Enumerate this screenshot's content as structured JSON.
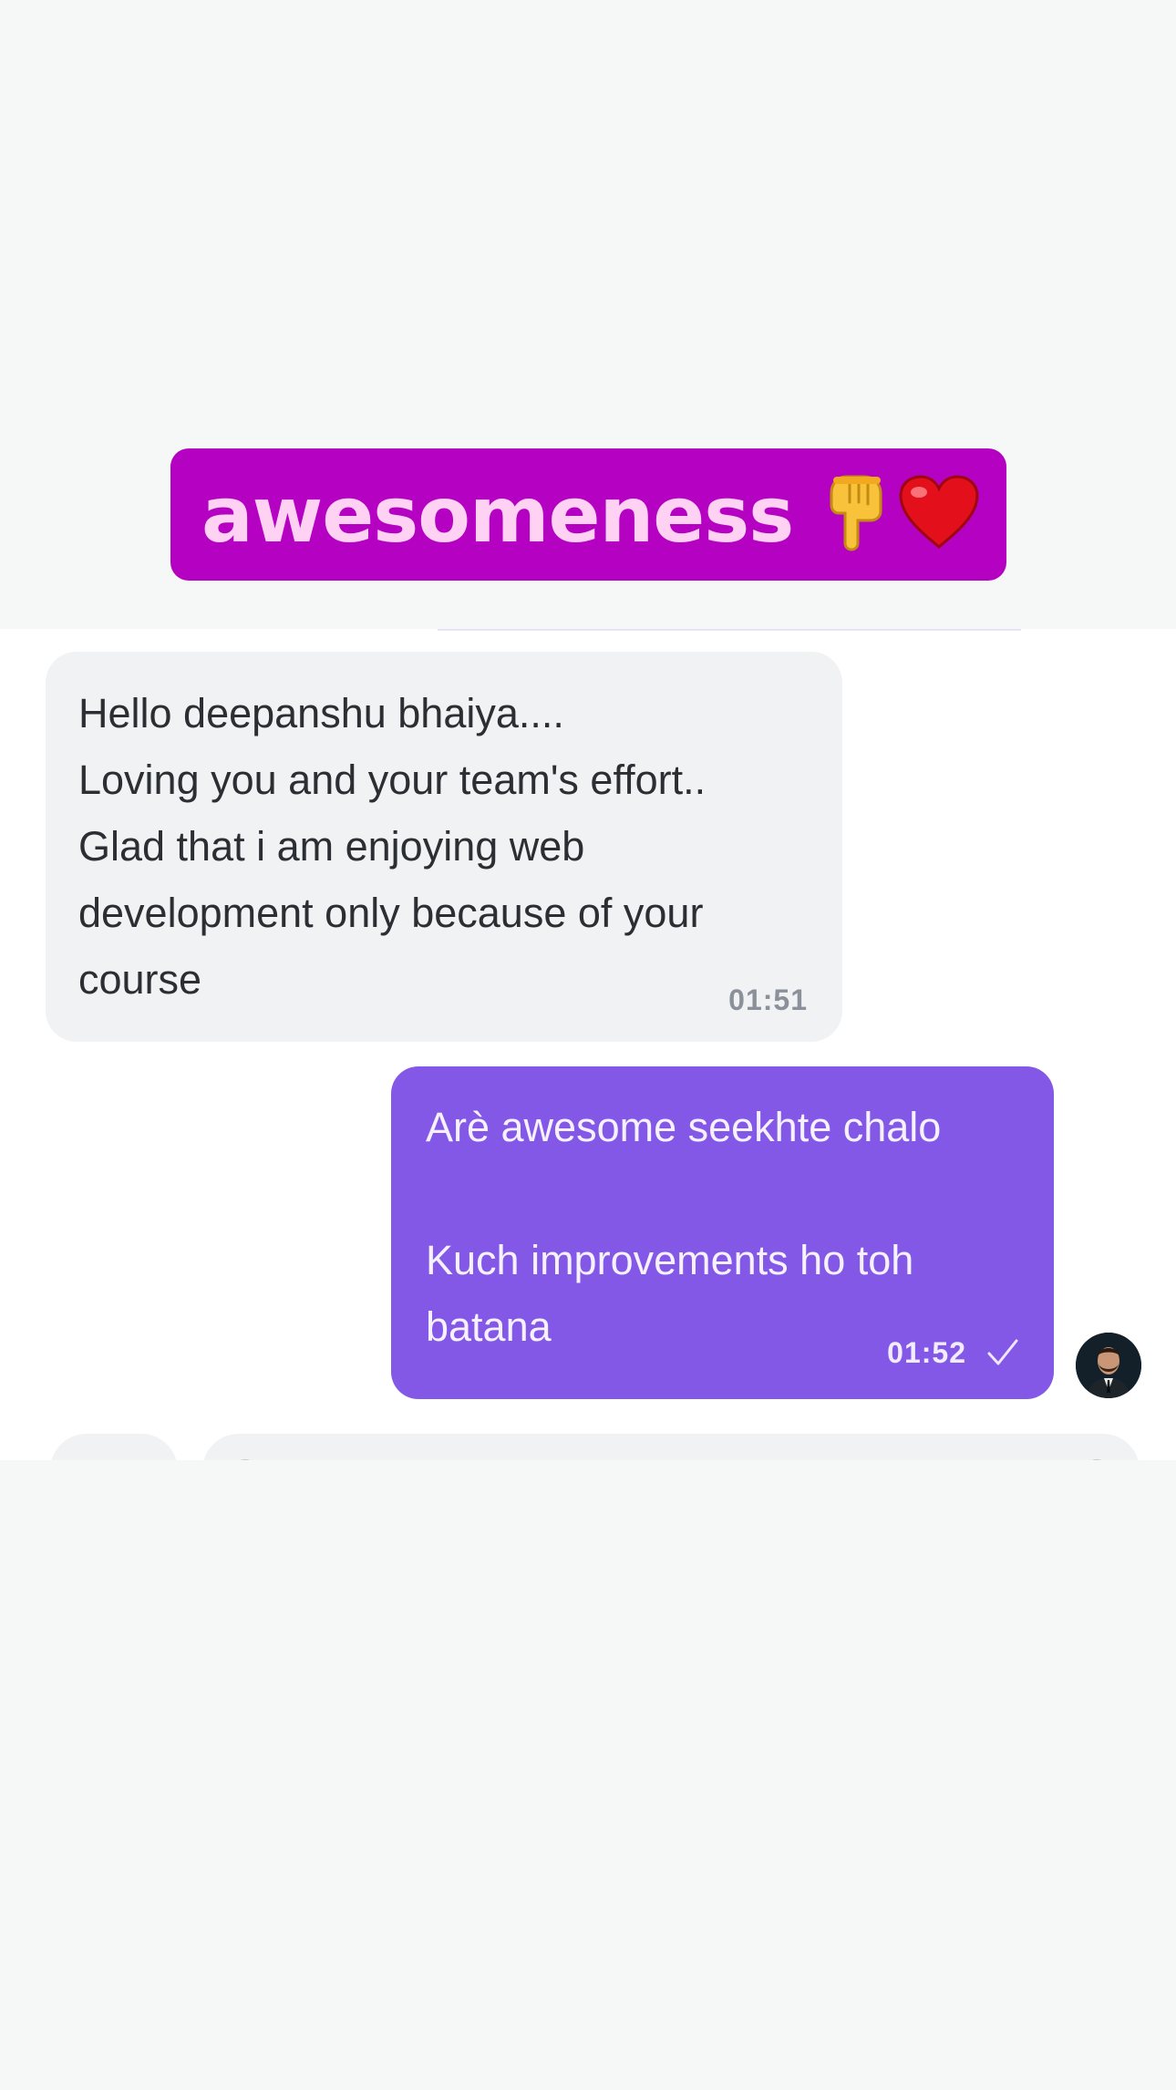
{
  "sticker": {
    "text": "awesomeness",
    "emoji_icons": [
      "pointing-down-hand-icon",
      "red-heart-icon"
    ],
    "background_color": "#b502c2",
    "text_color": "#ffd2f4"
  },
  "chat": {
    "incoming": {
      "lines": [
        "Hello deepanshu bhaiya....",
        "Loving you and your team's effort..",
        "Glad that i am enjoying web",
        "development only because of your",
        "course"
      ],
      "time": "01:51",
      "bubble_color": "#f1f2f4"
    },
    "outgoing": {
      "line_1": "Arè awesome seekhte chalo",
      "line_2": "Kuch improvements ho toh",
      "line_3": "batana",
      "time": "01:52",
      "status_icon": "check-icon",
      "bubble_color": "#8458e6"
    },
    "avatar_icon": "user-avatar"
  },
  "colors": {
    "page_background": "#f6f7f7",
    "panel_background": "#ffffff"
  }
}
